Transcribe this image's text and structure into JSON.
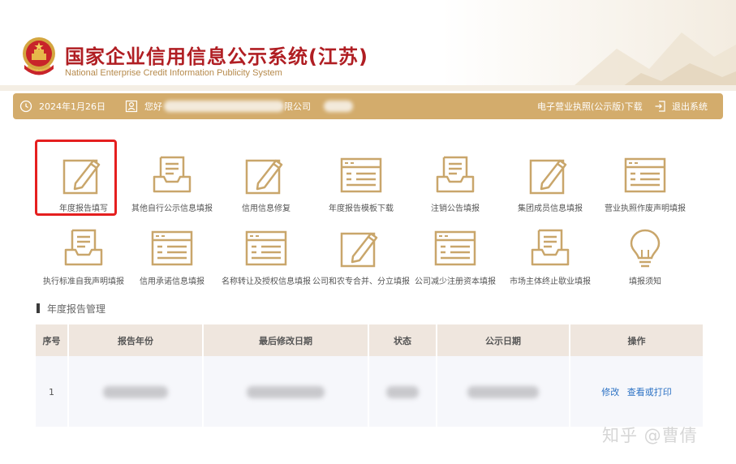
{
  "header": {
    "title": "国家企业信用信息公示系统(江苏)",
    "subtitle": "National Enterprise Credit Information Publicity System"
  },
  "topbar": {
    "date": "2024年1月26日",
    "greeting": "您好",
    "company_suffix": "限公司",
    "license_download": "电子营业执照(公示版)下载",
    "logout": "退出系统"
  },
  "tiles": [
    {
      "label": "年度报告填写",
      "icon": "edit-doc-icon"
    },
    {
      "label": "其他自行公示信息填报",
      "icon": "inbox-tray-icon"
    },
    {
      "label": "信用信息修复",
      "icon": "edit-doc-icon"
    },
    {
      "label": "年度报告模板下载",
      "icon": "template-list-icon"
    },
    {
      "label": "注销公告填报",
      "icon": "inbox-tray-icon"
    },
    {
      "label": "集团成员信息填报",
      "icon": "edit-doc-icon"
    },
    {
      "label": "营业执照作废声明填报",
      "icon": "template-list-icon"
    },
    {
      "label": "执行标准自我声明填报",
      "icon": "inbox-tray-icon"
    },
    {
      "label": "信用承诺信息填报",
      "icon": "template-list-icon"
    },
    {
      "label": "名称转让及授权信息填报",
      "icon": "template-list-icon"
    },
    {
      "label": "公司和农专合并、分立填报",
      "icon": "edit-doc-icon"
    },
    {
      "label": "公司减少注册资本填报",
      "icon": "template-list-icon"
    },
    {
      "label": "市场主体终止歇业填报",
      "icon": "inbox-tray-icon"
    },
    {
      "label": "填报须知",
      "icon": "lightbulb-icon"
    }
  ],
  "section": {
    "title": "年度报告管理"
  },
  "table": {
    "headers": [
      "序号",
      "报告年份",
      "最后修改日期",
      "状态",
      "公示日期",
      "操作"
    ],
    "rows": [
      {
        "index": "1",
        "actions": [
          "修改",
          "查看或打印"
        ]
      }
    ]
  },
  "watermark": "知乎 @曹倩",
  "colors": {
    "brand_red": "#b01e23",
    "gold": "#d3ac6c",
    "icon_gold": "#c9a66b",
    "link_blue": "#2c72c4",
    "highlight_red": "#e51f1f"
  }
}
